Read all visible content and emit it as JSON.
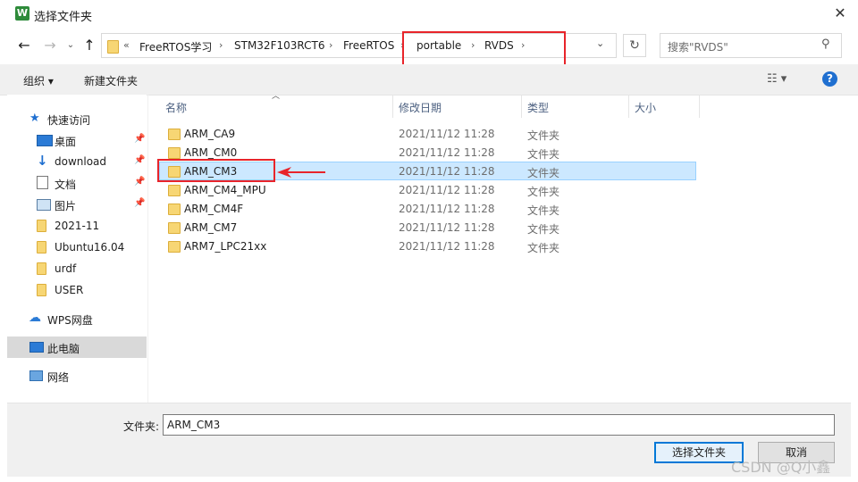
{
  "window": {
    "title": "选择文件夹",
    "app_icon_letter": "W"
  },
  "address": {
    "crumbs": [
      "FreeRTOS学习",
      "STM32F103RCT6",
      "FreeRTOS",
      "portable",
      "RVDS"
    ],
    "overflow": "«"
  },
  "search": {
    "placeholder": "搜索\"RVDS\""
  },
  "toolbar": {
    "organize": "组织 ▾",
    "new_folder": "新建文件夹"
  },
  "nav": {
    "items": [
      {
        "label": "快速访问"
      },
      {
        "label": "桌面"
      },
      {
        "label": "download"
      },
      {
        "label": "文档"
      },
      {
        "label": "图片"
      },
      {
        "label": "2021-11"
      },
      {
        "label": "Ubuntu16.04"
      },
      {
        "label": "urdf"
      },
      {
        "label": "USER"
      },
      {
        "label": "WPS网盘"
      },
      {
        "label": "此电脑"
      },
      {
        "label": "网络"
      }
    ]
  },
  "columns": {
    "name": "名称",
    "date": "修改日期",
    "type": "类型",
    "size": "大小"
  },
  "files": [
    {
      "name": "ARM_CA9",
      "date": "2021/11/12 11:28",
      "type": "文件夹"
    },
    {
      "name": "ARM_CM0",
      "date": "2021/11/12 11:28",
      "type": "文件夹"
    },
    {
      "name": "ARM_CM3",
      "date": "2021/11/12 11:28",
      "type": "文件夹"
    },
    {
      "name": "ARM_CM4_MPU",
      "date": "2021/11/12 11:28",
      "type": "文件夹"
    },
    {
      "name": "ARM_CM4F",
      "date": "2021/11/12 11:28",
      "type": "文件夹"
    },
    {
      "name": "ARM_CM7",
      "date": "2021/11/12 11:28",
      "type": "文件夹"
    },
    {
      "name": "ARM7_LPC21xx",
      "date": "2021/11/12 11:28",
      "type": "文件夹"
    }
  ],
  "bottom": {
    "filename_label": "文件夹:",
    "filename_value": "ARM_CM3",
    "select_button": "选择文件夹",
    "cancel_button": "取消"
  },
  "watermark": "CSDN @Q小鑫",
  "colors": {
    "accent": "#0078d7",
    "selection": "#cce8ff",
    "annotation": "#e8242a",
    "folder": "#f7d674"
  }
}
